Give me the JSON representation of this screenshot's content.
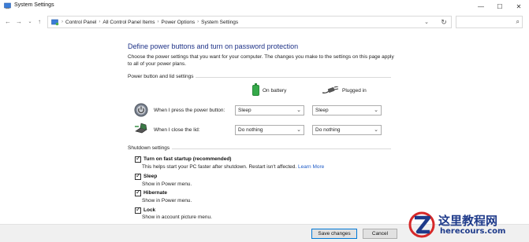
{
  "window": {
    "title": "System Settings",
    "controls": {
      "minimize": "—",
      "maximize": "☐",
      "close": "✕"
    }
  },
  "navigation": {
    "back": "←",
    "forward": "→",
    "dropdown": "⌄",
    "up": "↑",
    "breadcrumbs": [
      "Control Panel",
      "All Control Panel Items",
      "Power Options",
      "System Settings"
    ],
    "separator": "›",
    "address_dropdown": "⌄",
    "refresh": "↻",
    "search_placeholder": ""
  },
  "main": {
    "heading": "Define power buttons and turn on password protection",
    "intro": "Choose the power settings that you want for your computer. The changes you make to the settings on this page apply to all of your power plans.",
    "power_group": {
      "label": "Power button and lid settings",
      "columns": {
        "battery": "On battery",
        "plugged": "Plugged in"
      },
      "rows": [
        {
          "label": "When I press the power button:",
          "battery": "Sleep",
          "plugged": "Sleep"
        },
        {
          "label": "When I close the lid:",
          "battery": "Do nothing",
          "plugged": "Do nothing"
        }
      ]
    },
    "shutdown_group": {
      "label": "Shutdown settings",
      "items": [
        {
          "title": "Turn on fast startup (recommended)",
          "desc": "This helps start your PC faster after shutdown. Restart isn't affected.",
          "link": "Learn More",
          "checked": true
        },
        {
          "title": "Sleep",
          "desc": "Show in Power menu.",
          "checked": true
        },
        {
          "title": "Hibernate",
          "desc": "Show in Power menu.",
          "checked": true
        },
        {
          "title": "Lock",
          "desc": "Show in account picture menu.",
          "checked": true
        }
      ]
    }
  },
  "footer": {
    "save": "Save changes",
    "cancel": "Cancel"
  },
  "watermark": {
    "text_cn": "这里教程网",
    "url": "herecours.com"
  },
  "colors": {
    "heading": "#1e3287",
    "link": "#1e5bc6",
    "battery": "#35a94a",
    "watermark": "#1e3a8a"
  }
}
